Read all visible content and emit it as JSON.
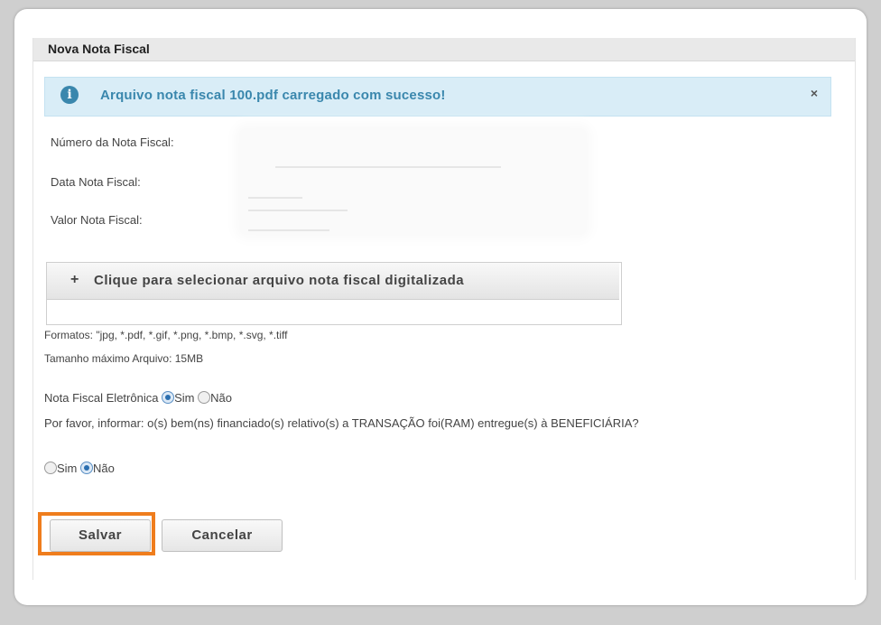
{
  "dialog": {
    "title": "Nova Nota Fiscal"
  },
  "alert": {
    "icon": "info-icon",
    "icon_glyph": "i",
    "message": "Arquivo nota fiscal 100.pdf carregado com sucesso!",
    "close_glyph": "×",
    "color": "#3a87ad",
    "background": "#d9edf7"
  },
  "fields": {
    "numero_label": "Número da Nota Fiscal:",
    "data_label": "Data Nota Fiscal:",
    "valor_label": "Valor Nota Fiscal:"
  },
  "upload": {
    "plus": "+",
    "button_label": "Clique para selecionar arquivo nota fiscal digitalizada",
    "formats": "Formatos: \"jpg, *.pdf, *.gif, *.png, *.bmp, *.svg, *.tiff",
    "max_size": "Tamanho máximo Arquivo: 15MB"
  },
  "eletronica": {
    "label": "Nota Fiscal Eletrônica",
    "option_yes": "Sim",
    "option_no": "Não",
    "selected": "Sim"
  },
  "entrega": {
    "question": "Por favor, informar: o(s) bem(ns) financiado(s) relativo(s) a TRANSAÇÃO foi(RAM) entregue(s) à BENEFICIÁRIA?",
    "option_yes": "Sim",
    "option_no": "Não",
    "selected": "Não"
  },
  "actions": {
    "save_label": "Salvar",
    "cancel_label": "Cancelar",
    "highlight_color": "#ef7d1d"
  }
}
